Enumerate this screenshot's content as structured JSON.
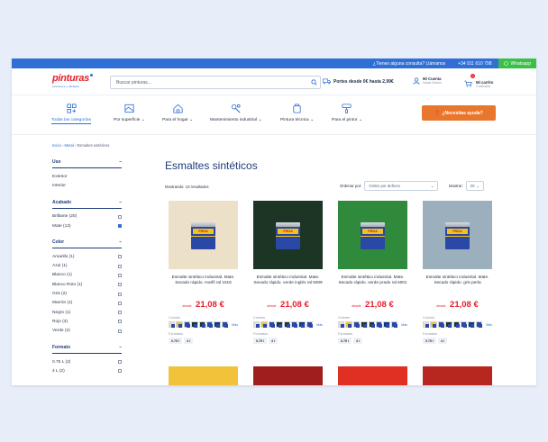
{
  "topbar": {
    "contact": "¿Tienes alguna consulta? Llámanos",
    "phone": "+34 911 610 798",
    "whatsapp": "Whatsapp"
  },
  "header": {
    "logo": "pinturas",
    "logo_sub": "soluciones y calidades",
    "search_placeholder": "Buscar pinturas...",
    "shipping": "Portes desde 0€ hasta 2,99€",
    "account_label": "Mi Cuenta",
    "account_sub": "Iniciar Sesión",
    "cart_label": "Mi carrito",
    "cart_sub": "0 artículos",
    "cart_count": "0"
  },
  "nav": {
    "items": [
      {
        "label": "Todas las categorías",
        "icon": "grid-icon",
        "active": true
      },
      {
        "label": "Por superficie",
        "icon": "surface-icon",
        "active": false
      },
      {
        "label": "Para el hogar",
        "icon": "home-icon",
        "active": false
      },
      {
        "label": "Mantenimiento industrial",
        "icon": "industrial-icon",
        "active": false
      },
      {
        "label": "Pintura técnica",
        "icon": "technical-icon",
        "active": false
      },
      {
        "label": "Para el pintor",
        "icon": "painter-icon",
        "active": false
      }
    ],
    "help_label": "¿Necesitas ayuda?"
  },
  "breadcrumb": {
    "items": [
      "Inicio",
      "Metal",
      "Esmaltes sintéticos"
    ]
  },
  "sidebar": {
    "filters": [
      {
        "title": "Uso",
        "options": [
          {
            "label": "Exterior",
            "checkbox": false
          },
          {
            "label": "Interior",
            "checkbox": false
          }
        ]
      },
      {
        "title": "Acabado",
        "options": [
          {
            "label": "Brillante  (20)",
            "checkbox": true,
            "checked": false
          },
          {
            "label": "Mate  (13)",
            "checkbox": true,
            "checked": true
          }
        ]
      },
      {
        "title": "Color",
        "options": [
          {
            "label": "Amarillo  (1)",
            "checkbox": true,
            "checked": false
          },
          {
            "label": "Azul  (1)",
            "checkbox": true,
            "checked": false
          },
          {
            "label": "Blanco  (1)",
            "checkbox": true,
            "checked": false
          },
          {
            "label": "Blanco Roto  (1)",
            "checkbox": true,
            "checked": false
          },
          {
            "label": "Gris  (2)",
            "checkbox": true,
            "checked": false
          },
          {
            "label": "Marrón  (1)",
            "checkbox": true,
            "checked": false
          },
          {
            "label": "Negro  (1)",
            "checkbox": true,
            "checked": false
          },
          {
            "label": "Rojo  (3)",
            "checkbox": true,
            "checked": false
          },
          {
            "label": "Verde  (2)",
            "checkbox": true,
            "checked": false
          }
        ]
      },
      {
        "title": "Formato",
        "options": [
          {
            "label": "0.75 L  (2)",
            "checkbox": true,
            "checked": false
          },
          {
            "label": "4 L  (2)",
            "checkbox": true,
            "checked": false
          }
        ]
      }
    ]
  },
  "main": {
    "title": "Esmaltes sintéticos",
    "results": "Mostrando: 13 resultados",
    "sort_label": "Ordenar por:",
    "sort_value": "Orden por defecto",
    "show_label": "Mostrar:",
    "show_value": "20",
    "colors_label": "Colores",
    "formats_label": "Formatos",
    "more_label": "Más",
    "from_label": "desde",
    "brand": "PROA",
    "products": [
      {
        "name": "Esmalte sintético industrial. Mate. Secado rápido. marfil ral 1015",
        "price": "21,08 €",
        "color": "#ede0c8",
        "formats": [
          "0.75 l",
          "4 l"
        ]
      },
      {
        "name": "Esmalte sintético industrial. Mate. Secado rápido. verde inglés ral 6009",
        "price": "21,08 €",
        "color": "#1c3524",
        "formats": [
          "0.75 l",
          "4 l"
        ]
      },
      {
        "name": "Esmalte sintético industrial. Mate. Secado rápido. verde prado ral 6001",
        "price": "21,08 €",
        "color": "#2f8a3c",
        "formats": [
          "0.75 l",
          "4 l"
        ]
      },
      {
        "name": "Esmalte sintético industrial. Mate. Secado rápido. gris perla",
        "price": "21,08 €",
        "color": "#9cafbc",
        "formats": [
          "0.75 l",
          "4 l"
        ]
      }
    ],
    "next_row_colors": [
      "#f1c23a",
      "#a01f1d",
      "#e03024",
      "#b7271f"
    ],
    "chip_colors": [
      "#ede0c8",
      "#f1c23a",
      "#2a48a6",
      "#1c3524",
      "#1c3524",
      "#2a48a6",
      "#0d3a78",
      "#2a48a6"
    ]
  }
}
